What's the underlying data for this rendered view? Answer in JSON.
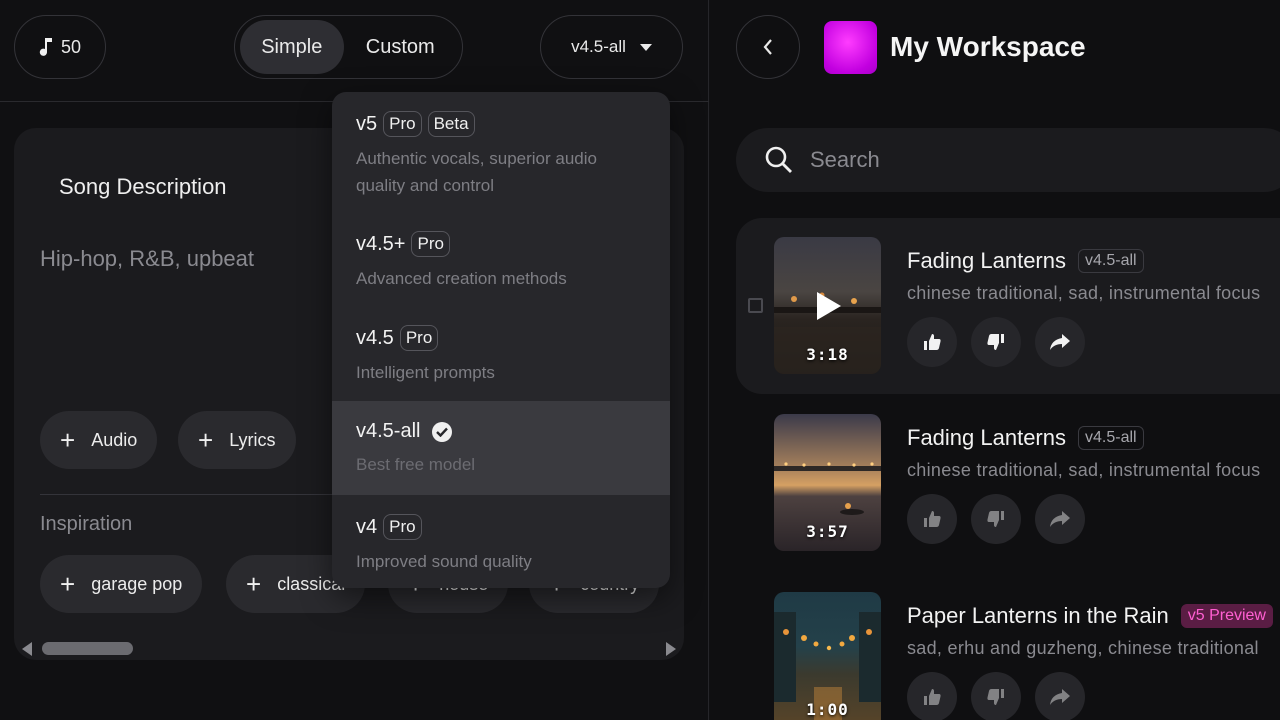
{
  "header": {
    "credits": "50",
    "mode_simple": "Simple",
    "mode_custom": "Custom",
    "version": "v4.5-all"
  },
  "create": {
    "song_description_label": "Song Description",
    "description_placeholder": "Hip-hop, R&B, upbeat",
    "audio_label": "Audio",
    "lyrics_label": "Lyrics",
    "inspiration_label": "Inspiration",
    "inspiration_chips": [
      "garage pop",
      "classical",
      "house",
      "country"
    ]
  },
  "model_menu": {
    "items": [
      {
        "name": "v5",
        "badges": [
          "Pro",
          "Beta"
        ],
        "description": "Authentic vocals, superior audio quality and control",
        "selected": false
      },
      {
        "name": "v4.5+",
        "badges": [
          "Pro"
        ],
        "description": "Advanced creation methods",
        "selected": false
      },
      {
        "name": "v4.5",
        "badges": [
          "Pro"
        ],
        "description": "Intelligent prompts",
        "selected": false
      },
      {
        "name": "v4.5-all",
        "badges": [],
        "description": "Best free model",
        "selected": true
      },
      {
        "name": "v4",
        "badges": [
          "Pro"
        ],
        "description": "Improved sound quality",
        "selected": false
      }
    ]
  },
  "workspace": {
    "title": "My Workspace",
    "search_placeholder": "Search",
    "songs": [
      {
        "title": "Fading Lanterns",
        "version": "v4.5-all",
        "tags": "chinese traditional, sad, instrumental focus",
        "duration": "3:18"
      },
      {
        "title": "Fading Lanterns",
        "version": "v4.5-all",
        "tags": "chinese traditional, sad, instrumental focus",
        "duration": "3:57"
      },
      {
        "title": "Paper Lanterns in the Rain",
        "version": "v5 Preview",
        "tags": "sad, erhu and guzheng, chinese traditional",
        "duration": "1:00"
      }
    ]
  },
  "colors": {
    "background": "#101012",
    "card": "#1b1b1e",
    "accent_avatar": "#d400f0",
    "preview_tag": "#ff5fd2"
  }
}
